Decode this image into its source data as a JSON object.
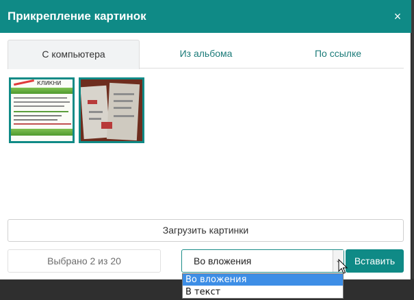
{
  "dialog": {
    "title": "Прикрепление картинок",
    "close": "×"
  },
  "tabs": [
    {
      "label": "С компьютера",
      "active": true
    },
    {
      "label": "Из альбома",
      "active": false
    },
    {
      "label": "По ссылке",
      "active": false
    }
  ],
  "thumbnails": [
    {
      "caption": "КЛИКНИ"
    },
    {
      "caption": ""
    }
  ],
  "actions": {
    "upload_label": "Загрузить картинки",
    "selected_text": "Выбрано 2 из 20",
    "insert_label": "Вставить"
  },
  "insert_mode": {
    "value": "Во вложения",
    "options": [
      "Во вложения",
      "В текст"
    ],
    "highlighted": "Во вложения"
  },
  "colors": {
    "accent": "#0f8a86",
    "highlight": "#3d8ee6"
  }
}
